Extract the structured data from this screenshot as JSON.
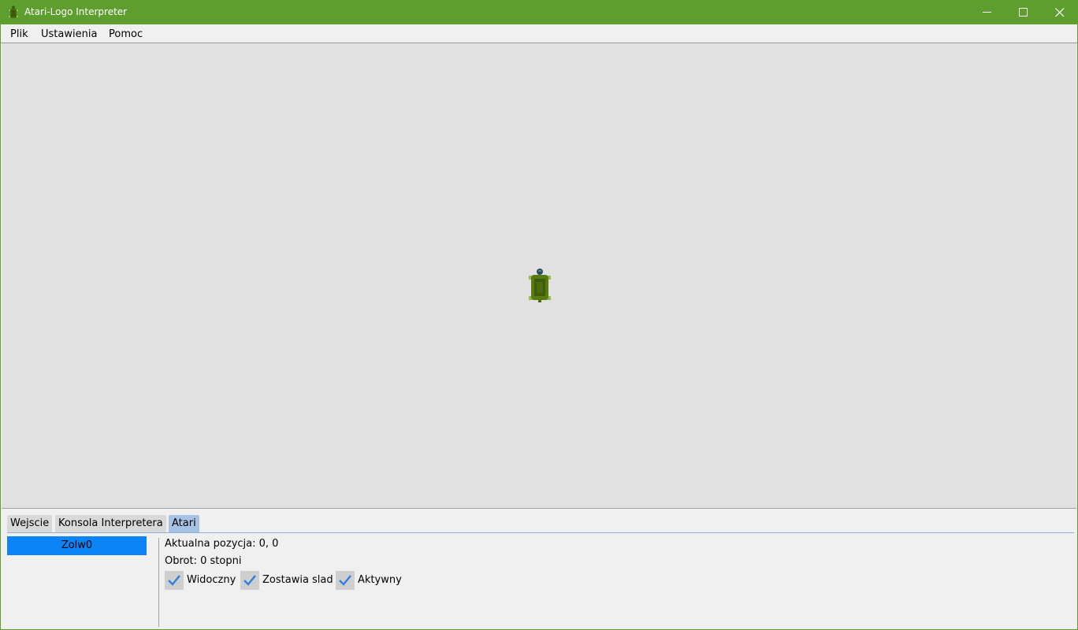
{
  "window": {
    "title": "Atari-Logo Interpreter",
    "accent_color": "#5e9e2f",
    "icon": "turtle-icon"
  },
  "menu": [
    "Plik",
    "Ustawienia",
    "Pomoc"
  ],
  "canvas": {
    "background": "#e1e1e1",
    "turtle_icon": "turtle-icon"
  },
  "tabs": [
    {
      "label": "Wejscie",
      "active": false
    },
    {
      "label": "Konsola Interpretera",
      "active": false
    },
    {
      "label": "Atari",
      "active": true
    }
  ],
  "turtles": [
    {
      "name": "Zolw0",
      "selected": true
    }
  ],
  "info": {
    "position": "Aktualna pozycja: 0, 0",
    "rotation": "Obrot: 0 stopni"
  },
  "checkboxes": [
    {
      "label": "Widoczny",
      "checked": true
    },
    {
      "label": "Zostawia slad",
      "checked": true
    },
    {
      "label": "Aktywny",
      "checked": true
    }
  ]
}
